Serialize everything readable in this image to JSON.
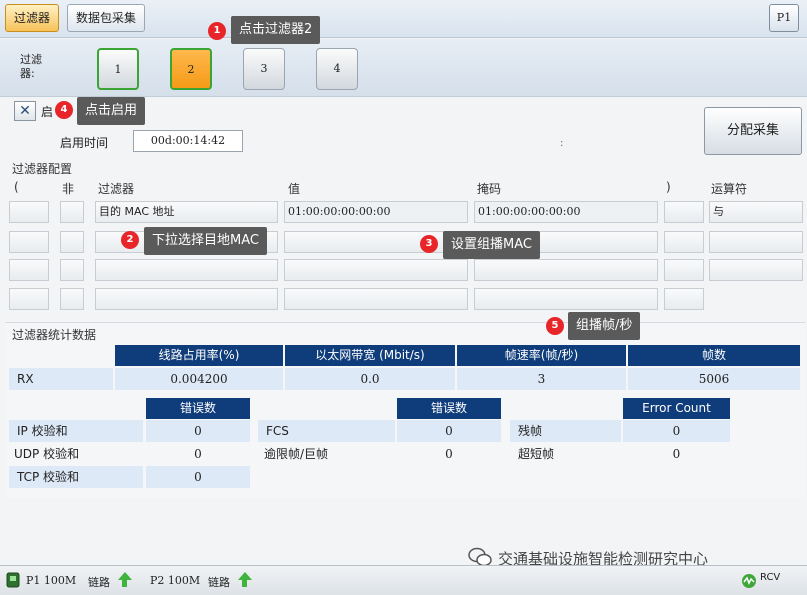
{
  "tabs": [
    "过滤器",
    "数据包采集"
  ],
  "port_button": "P1",
  "filter_select": {
    "label": "过滤器:",
    "buttons": [
      "1",
      "2",
      "3",
      "4"
    ]
  },
  "enable": {
    "checkbox_mark": "✕",
    "label": "启",
    "time_label": "启用时间",
    "time_value": "00d:00:14:42",
    "colon": ":",
    "alloc_button": "分配采集"
  },
  "filter_config": {
    "title": "过滤器配置",
    "headers": {
      "paren_open": "(",
      "not": "非",
      "filter": "过滤器",
      "value": "值",
      "mask": "掩码",
      "paren_close": ")",
      "operator": "运算符"
    },
    "row1": {
      "filter": "目的 MAC 地址",
      "value": "01:00:00:00:00:00",
      "mask": "01:00:00:00:00:00",
      "operator": "与"
    }
  },
  "stats": {
    "title": "过滤器统计数据",
    "headers": [
      "线路占用率(%)",
      "以太网带宽 (Mbit/s)",
      "帧速率(帧/秒)",
      "帧数"
    ],
    "row_label": "RX",
    "row_values": [
      "0.004200",
      "0.0",
      "3",
      "5006"
    ],
    "error_header": "错误数",
    "error_count_header": "Error Count",
    "col1": [
      {
        "label": "IP 校验和",
        "value": "0"
      },
      {
        "label": "UDP 校验和",
        "value": "0"
      },
      {
        "label": "TCP 校验和",
        "value": "0"
      }
    ],
    "col2": [
      {
        "label": "FCS",
        "value": "0"
      },
      {
        "label": "逾限帧/巨帧",
        "value": "0"
      }
    ],
    "col3": [
      {
        "label": "残帧",
        "value": "0"
      },
      {
        "label": "超短帧",
        "value": "0"
      }
    ]
  },
  "statusbar": {
    "p1": "P1 100M",
    "p1_link": "链路",
    "p2": "P2 100M",
    "p2_link": "链路",
    "rcv": "RCV"
  },
  "callouts": [
    {
      "num": "1",
      "text": "点击过滤器2"
    },
    {
      "num": "2",
      "text": "下拉选择目地MAC"
    },
    {
      "num": "3",
      "text": "设置组播MAC"
    },
    {
      "num": "4",
      "text": "点击启用"
    },
    {
      "num": "5",
      "text": "组播帧/秒"
    }
  ],
  "watermark": "交通基础设施智能检测研究中心",
  "colors": {
    "accent_orange": "#f59b17",
    "header_navy": "#0f3c7a",
    "callout_red": "#e8262a",
    "green": "#3aa535"
  }
}
